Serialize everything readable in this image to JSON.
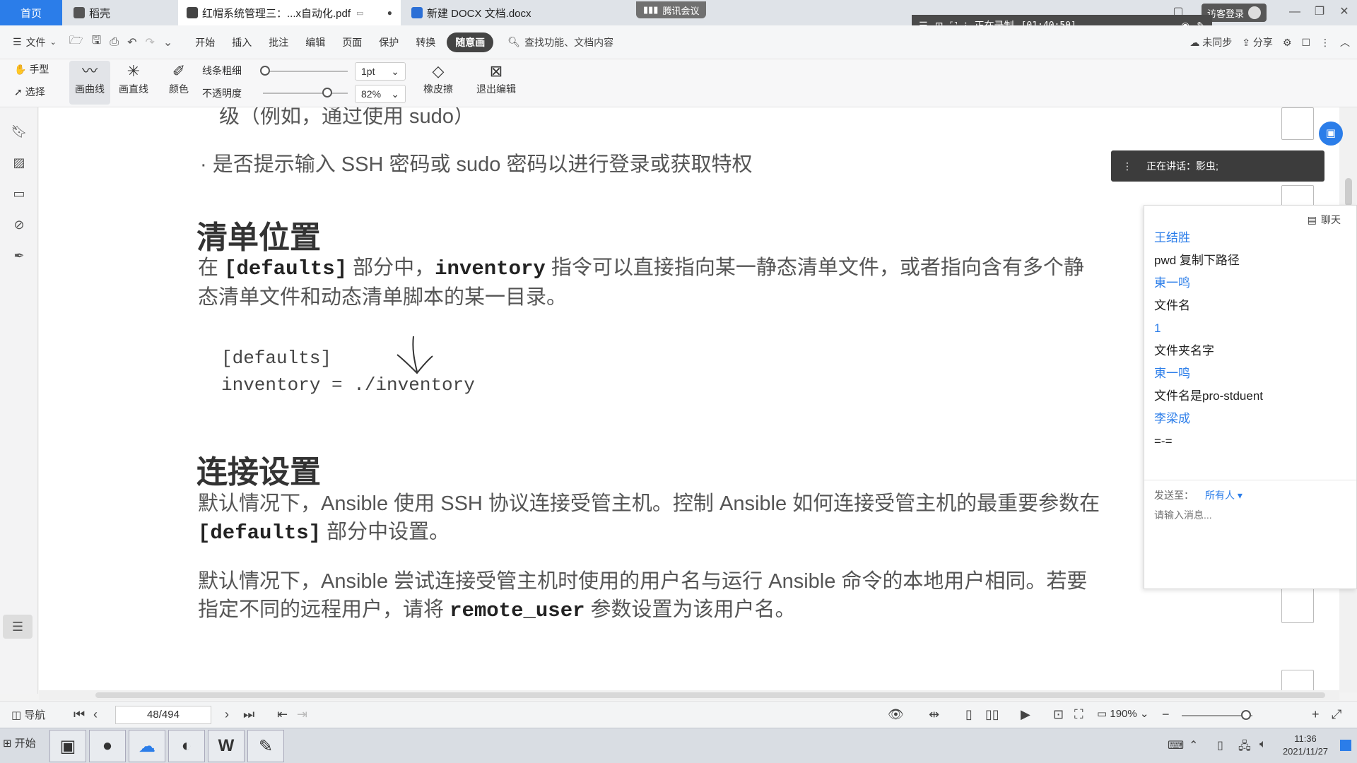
{
  "tabs": {
    "home": "首页",
    "wps": "稻壳",
    "pdf": "红帽系统管理三：...x自动化.pdf",
    "docx": "新建 DOCX 文档.docx"
  },
  "meeting_label": "腾讯会议",
  "login_label": "访客登录",
  "recording": {
    "label": "正在录制",
    "time": "[01:40:50]"
  },
  "menu": {
    "file": "文件",
    "items": [
      "开始",
      "插入",
      "批注",
      "编辑",
      "页面",
      "保护",
      "转换"
    ],
    "active": "随意画",
    "search": "查找功能、文档内容",
    "sync": "未同步",
    "share": "分享"
  },
  "draw_toolbar": {
    "hand": "手型",
    "select": "选择",
    "curve": "画曲线",
    "line": "画直线",
    "color": "颜色",
    "thickness_label": "线条粗细",
    "opacity_label": "不透明度",
    "thickness_value": "1pt",
    "opacity_value": "82%",
    "eraser": "橡皮擦",
    "exit": "退出编辑"
  },
  "document": {
    "partial_line": "级（例如，通过使用 sudo）",
    "bullet": "· 是否提示输入 SSH 密码或 sudo 密码以进行登录或获取特权",
    "h1": "清单位置",
    "p1_pre": "在 ",
    "p1_code1": "[defaults]",
    "p1_mid": " 部分中，",
    "p1_code2": "inventory",
    "p1_post": " 指令可以直接指向某一静态清单文件，或者指向含有多个静",
    "p1_line2": "态清单文件和动态清单脚本的某一目录。",
    "code_line1": "[defaults]",
    "code_line2": "inventory = ./inventory",
    "h2": "连接设置",
    "p2_line1": "默认情况下，Ansible 使用 SSH 协议连接受管主机。控制 Ansible 如何连接受管主机的最重要参数在",
    "p2_code": "[defaults]",
    "p2_line2_post": " 部分中设置。",
    "p3_line1": "默认情况下，Ansible 尝试连接受管主机时使用的用户名与运行 Ansible 命令的本地用户相同。若要",
    "p3_line2_pre": "指定不同的远程用户，请将 ",
    "p3_code": "remote_user",
    "p3_line2_post": " 参数设置为该用户名。"
  },
  "speaking": "正在讲话：影虫;",
  "chat": {
    "title": "聊天",
    "messages": [
      {
        "type": "name",
        "text": "王结胜"
      },
      {
        "type": "text",
        "text": "pwd 复制下路径"
      },
      {
        "type": "name",
        "text": "東一鸣"
      },
      {
        "type": "text",
        "text": "文件名"
      },
      {
        "type": "name",
        "text": "1"
      },
      {
        "type": "text",
        "text": "文件夹名字"
      },
      {
        "type": "name",
        "text": "東一鸣"
      },
      {
        "type": "text",
        "text": "文件名是pro-stduent"
      },
      {
        "type": "name",
        "text": "李梁成"
      },
      {
        "type": "text",
        "text": "=-="
      }
    ],
    "sendto_label": "发送至：",
    "sendto_target": "所有人",
    "input_placeholder": "请输入消息..."
  },
  "statusbar": {
    "nav": "导航",
    "page": "48/494",
    "zoom": "190%"
  },
  "taskbar": {
    "start": "开始",
    "time": "11:36",
    "date": "2021/11/27"
  }
}
